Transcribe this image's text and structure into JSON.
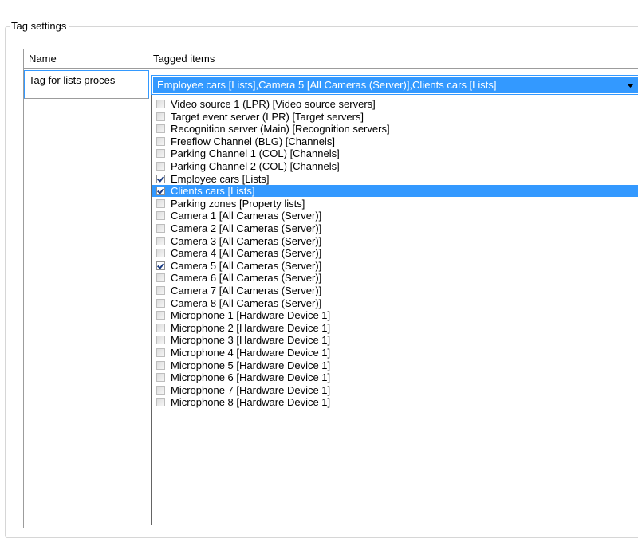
{
  "group": {
    "title": "Tag settings"
  },
  "grid": {
    "columns": [
      "Name",
      "Tagged items"
    ],
    "row": {
      "name": "Tag for lists proces",
      "tagged_value": "Employee cars [Lists],Camera 5 [All Cameras (Server)],Clients cars [Lists]"
    }
  },
  "dropdown": {
    "items": [
      {
        "label": "Video source 1 (LPR) [Video source servers]",
        "checked": false,
        "selected": false
      },
      {
        "label": "Target event server (LPR) [Target servers]",
        "checked": false,
        "selected": false
      },
      {
        "label": "Recognition server (Main) [Recognition servers]",
        "checked": false,
        "selected": false
      },
      {
        "label": "Freeflow Channel (BLG) [Channels]",
        "checked": false,
        "selected": false
      },
      {
        "label": "Parking Channel 1 (COL) [Channels]",
        "checked": false,
        "selected": false
      },
      {
        "label": "Parking Channel 2 (COL) [Channels]",
        "checked": false,
        "selected": false
      },
      {
        "label": "Employee cars [Lists]",
        "checked": true,
        "selected": false
      },
      {
        "label": "Clients cars [Lists]",
        "checked": true,
        "selected": true
      },
      {
        "label": "Parking zones [Property lists]",
        "checked": false,
        "selected": false
      },
      {
        "label": "Camera 1 [All Cameras (Server)]",
        "checked": false,
        "selected": false
      },
      {
        "label": "Camera 2 [All Cameras (Server)]",
        "checked": false,
        "selected": false
      },
      {
        "label": "Camera 3 [All Cameras (Server)]",
        "checked": false,
        "selected": false
      },
      {
        "label": "Camera 4 [All Cameras (Server)]",
        "checked": false,
        "selected": false
      },
      {
        "label": "Camera 5 [All Cameras (Server)]",
        "checked": true,
        "selected": false
      },
      {
        "label": "Camera 6 [All Cameras (Server)]",
        "checked": false,
        "selected": false
      },
      {
        "label": "Camera 7 [All Cameras (Server)]",
        "checked": false,
        "selected": false
      },
      {
        "label": "Camera 8 [All Cameras (Server)]",
        "checked": false,
        "selected": false
      },
      {
        "label": "Microphone 1 [Hardware Device 1]",
        "checked": false,
        "selected": false
      },
      {
        "label": "Microphone 2 [Hardware Device 1]",
        "checked": false,
        "selected": false
      },
      {
        "label": "Microphone 3 [Hardware Device 1]",
        "checked": false,
        "selected": false
      },
      {
        "label": "Microphone 4 [Hardware Device 1]",
        "checked": false,
        "selected": false
      },
      {
        "label": "Microphone 5 [Hardware Device 1]",
        "checked": false,
        "selected": false
      },
      {
        "label": "Microphone 6 [Hardware Device 1]",
        "checked": false,
        "selected": false
      },
      {
        "label": "Microphone 7 [Hardware Device 1]",
        "checked": false,
        "selected": false
      },
      {
        "label": "Microphone 8 [Hardware Device 1]",
        "checked": false,
        "selected": false
      }
    ]
  },
  "colors": {
    "selection": "#3399ff",
    "checkmark": "#1b3c82"
  },
  "icons": {
    "dropdown_arrow": "chevron-down-icon"
  }
}
